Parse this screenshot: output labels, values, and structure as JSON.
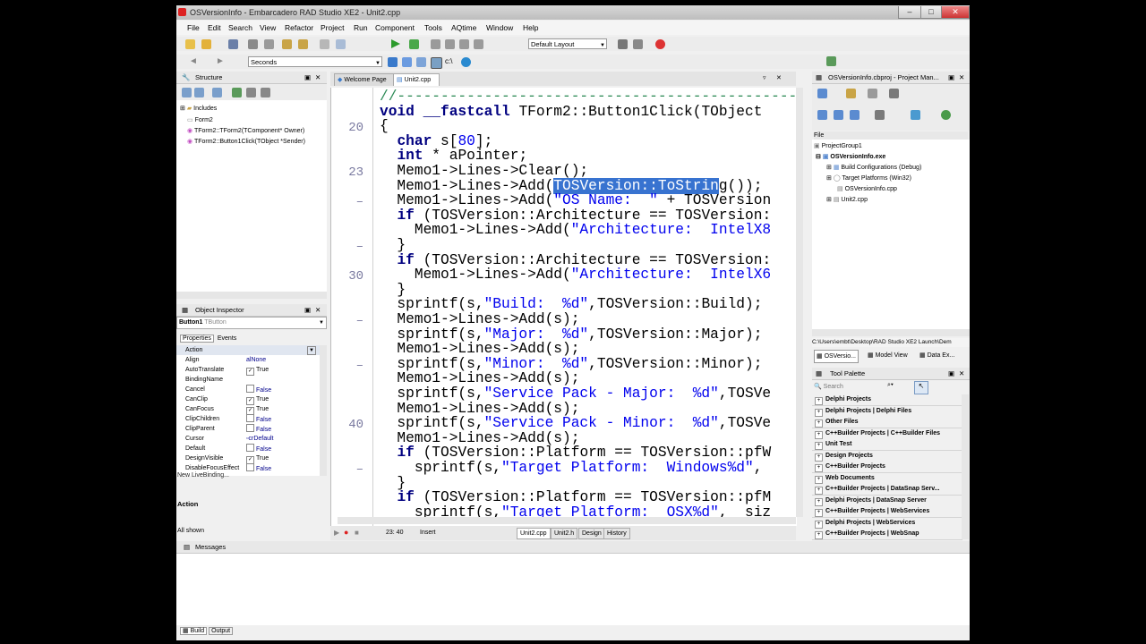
{
  "window": {
    "title": "OSVersionInfo - Embarcadero RAD Studio XE2 - Unit2.cpp"
  },
  "menu": [
    "File",
    "Edit",
    "Search",
    "View",
    "Refactor",
    "Project",
    "Run",
    "Component",
    "Tools",
    "AQtime",
    "Window",
    "Help"
  ],
  "toolbar": {
    "layout_combo": "Default Layout",
    "seconds_combo": "Seconds"
  },
  "structure": {
    "title": "Structure",
    "items": [
      "Includes",
      "Form2",
      "TForm2::TForm2(TComponent* Owner)",
      "TForm2::Button1Click(TObject *Sender)"
    ]
  },
  "object_inspector": {
    "title": "Object Inspector",
    "selected_name": "Button1",
    "selected_type": "TButton",
    "tabs": [
      "Properties",
      "Events"
    ],
    "rows": [
      {
        "name": "Action",
        "value": "",
        "check": ""
      },
      {
        "name": "Align",
        "value": "alNone",
        "check": ""
      },
      {
        "name": "AutoTranslate",
        "value": "True",
        "check": "✓"
      },
      {
        "name": "BindingName",
        "value": "",
        "check": ""
      },
      {
        "name": "Cancel",
        "value": "False",
        "check": ""
      },
      {
        "name": "CanClip",
        "value": "True",
        "check": "✓"
      },
      {
        "name": "CanFocus",
        "value": "True",
        "check": "✓"
      },
      {
        "name": "ClipChildren",
        "value": "False",
        "check": ""
      },
      {
        "name": "ClipParent",
        "value": "False",
        "check": ""
      },
      {
        "name": "Cursor",
        "value": "crDefault",
        "check": ""
      },
      {
        "name": "Default",
        "value": "False",
        "check": ""
      },
      {
        "name": "DesignVisible",
        "value": "True",
        "check": "✓"
      },
      {
        "name": "DisableFocusEffect",
        "value": "False",
        "check": ""
      }
    ],
    "live_binding": "New LiveBinding...",
    "desc_title": "Action",
    "status": "All shown"
  },
  "editor": {
    "tabs": [
      "Welcome Page",
      "Unit2.cpp"
    ],
    "line_numbers": [
      {
        "n": "20",
        "row": 2
      },
      {
        "n": "23",
        "row": 5
      },
      {
        "n": "–",
        "row": 7
      },
      {
        "n": "–",
        "row": 10
      },
      {
        "n": "30",
        "row": 12
      },
      {
        "n": "–",
        "row": 15
      },
      {
        "n": "–",
        "row": 18
      },
      {
        "n": "40",
        "row": 22
      },
      {
        "n": "–",
        "row": 25
      }
    ],
    "status": {
      "position": "23: 40",
      "mode": "Insert"
    },
    "bottom_tabs": [
      "Unit2.cpp",
      "Unit2.h",
      "Design",
      "History"
    ]
  },
  "project_manager": {
    "title": "OSVersionInfo.cbproj - Project Man...",
    "file_label": "File",
    "items": [
      "ProjectGroup1",
      "OSVersionInfo.exe",
      "Build Configurations (Debug)",
      "Target Platforms (Win32)",
      "OSVersionInfo.cpp",
      "Unit2.cpp"
    ],
    "path": "C:\\Users\\embt\\Desktop\\RAD Studio XE2 Launch\\Dem",
    "tabs": [
      "OSVersio...",
      "Model View",
      "Data Ex..."
    ]
  },
  "tool_palette": {
    "title": "Tool Palette",
    "search_placeholder": "Search",
    "categories": [
      "Delphi Projects",
      "Delphi Projects | Delphi Files",
      "Other Files",
      "C++Builder Projects | C++Builder Files",
      "Unit Test",
      "Design Projects",
      "C++Builder Projects",
      "Web Documents",
      "C++Builder Projects | DataSnap Serv...",
      "Delphi Projects | DataSnap Server",
      "C++Builder Projects | WebServices",
      "Delphi Projects | WebServices",
      "C++Builder Projects | WebSnap"
    ]
  },
  "messages": {
    "title": "Messages",
    "tabs": [
      "Build",
      "Output"
    ]
  }
}
